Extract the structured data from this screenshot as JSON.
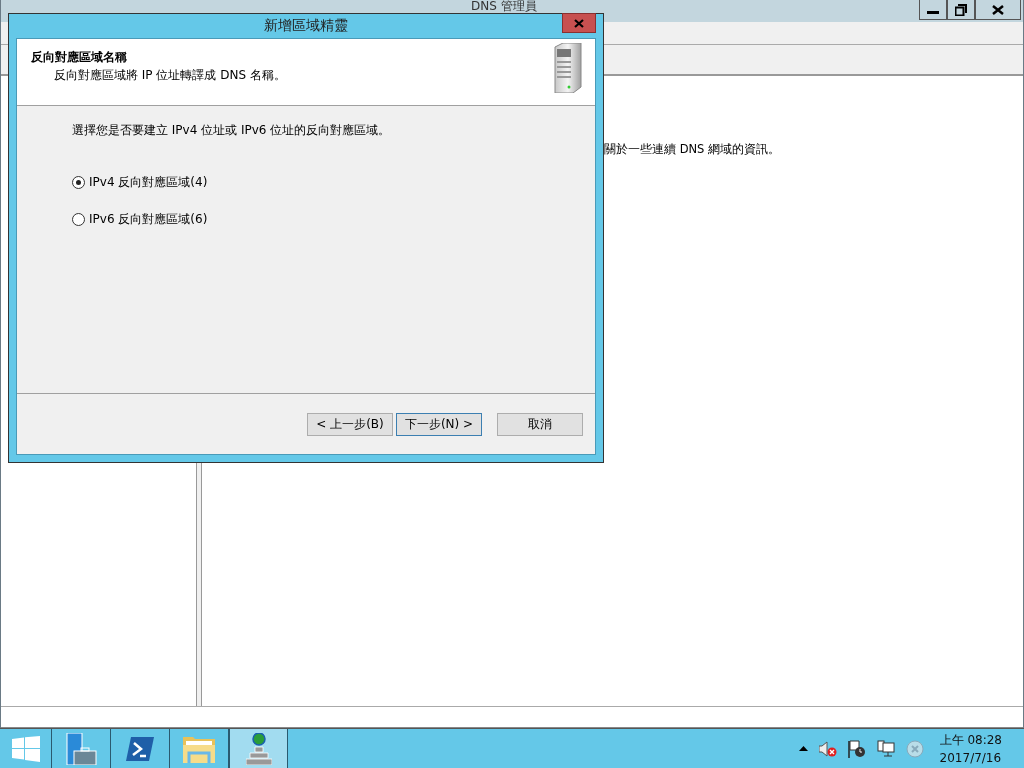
{
  "background_window": {
    "title": "DNS 管理員",
    "description": "關於一些連續 DNS 網域的資訊。"
  },
  "dialog": {
    "title": "新增區域精靈",
    "header_title": "反向對應區域名稱",
    "header_subtitle": "反向對應區域將 IP 位址轉譯成 DNS 名稱。",
    "prompt": "選擇您是否要建立 IPv4 位址或 IPv6 位址的反向對應區域。",
    "options": [
      {
        "label": "IPv4 反向對應區域(4)",
        "selected": true
      },
      {
        "label": "IPv6 反向對應區域(6)",
        "selected": false
      }
    ],
    "buttons": [
      {
        "label": "< 上一步(B)",
        "kind": "normal"
      },
      {
        "label": "下一步(N) >",
        "kind": "default"
      },
      {
        "label": "取消",
        "kind": "cancel"
      }
    ]
  },
  "taskbar": {
    "apps": [
      {
        "kind": "server-manager",
        "selected": false
      },
      {
        "kind": "powershell",
        "selected": false
      },
      {
        "kind": "explorer",
        "selected": false
      },
      {
        "kind": "dns",
        "selected": true
      }
    ],
    "clock": {
      "time": "上午 08:28",
      "date": "2017/7/16"
    }
  }
}
